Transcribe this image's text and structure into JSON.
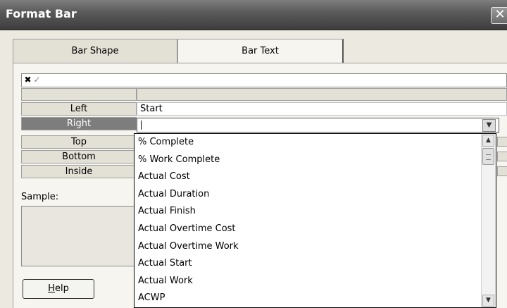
{
  "window": {
    "title": "Format Bar",
    "close_glyph": "✕"
  },
  "tabs": [
    {
      "label": "Bar Shape",
      "active": false
    },
    {
      "label": "Bar Text",
      "active": true
    }
  ],
  "editbar": {
    "cancel_icon": "✖",
    "accept_icon": "✓",
    "value": ""
  },
  "rows": [
    {
      "label": "Left",
      "value": "Start"
    },
    {
      "label": "Right",
      "value": ""
    },
    {
      "label": "Top",
      "value": ""
    },
    {
      "label": "Bottom",
      "value": ""
    },
    {
      "label": "Inside",
      "value": ""
    }
  ],
  "selected_row": "Right",
  "sample": {
    "label": "Sample:"
  },
  "help_button": {
    "mnemonic": "H",
    "rest": "elp"
  },
  "dropdown": {
    "items": [
      "% Complete",
      "% Work Complete",
      "Actual Cost",
      "Actual Duration",
      "Actual Finish",
      "Actual Overtime Cost",
      "Actual Overtime Work",
      "Actual Start",
      "Actual Work",
      "ACWP"
    ],
    "scroll_up_glyph": "▲",
    "scroll_down_glyph": "▼",
    "open_glyph": "▼"
  }
}
